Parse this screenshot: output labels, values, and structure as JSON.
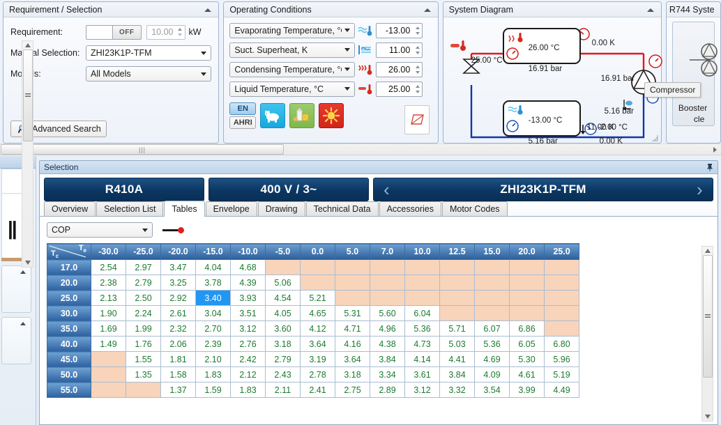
{
  "requirement_panel": {
    "title": "Requirement / Selection",
    "requirement_label": "Requirement:",
    "toggle_state": "OFF",
    "capacity_value": "10.00",
    "capacity_unit": "kW",
    "manual_selection_label": "Manual Selection:",
    "manual_selection_value": "ZHI23K1P-TFM",
    "models_label": "Models:",
    "models_value": "All Models",
    "advanced_search_label": "Advanced Search"
  },
  "operating_conditions": {
    "title": "Operating Conditions",
    "rows": [
      {
        "label": "Evaporating Temperature, °C",
        "icon": "evaporator-icon",
        "value": "-13.00"
      },
      {
        "label": "Suct. Superheat, K",
        "icon": "superheat-icon",
        "value": "11.00"
      },
      {
        "label": "Condensing Temperature, °C",
        "icon": "condenser-icon",
        "value": "26.00"
      },
      {
        "label": "Liquid Temperature, °C",
        "icon": "liquid-icon",
        "value": "25.00"
      }
    ],
    "standard_en": "EN",
    "standard_ahri": "AHRI",
    "app_buttons": [
      {
        "name": "low-temperature-application",
        "glyph": "🐻‍❄"
      },
      {
        "name": "medium-temperature-application",
        "glyph": "🧀"
      },
      {
        "name": "high-temperature-application",
        "glyph": "☀"
      }
    ],
    "ph_diagram_button": "ph-diagram-icon"
  },
  "system_diagram": {
    "title": "System Diagram",
    "condenser_temp": "26.00 °C",
    "condenser_pressure": "16.91 bar",
    "discharge_subcool": "0.00 K",
    "liquid_temp": "25.00 °C",
    "high_pressure": "16.91 bar",
    "low_pressure": "5.16 bar",
    "suction_temp": "-2.00 °C",
    "evaporating_temp": "-13.00 °C",
    "evaporating_pressure": "5.16 bar",
    "superheat": "11.00 K",
    "suction_line_loss": "0.00 K",
    "tooltip": "Compressor"
  },
  "r744_panel": {
    "title": "R744 Syste",
    "subtitle_line1": "Booster",
    "subtitle_line2": "cle"
  },
  "selection": {
    "header_title": "Selection",
    "refrigerant": "R410A",
    "voltage": "400 V / 3~",
    "model": "ZHI23K1P-TFM",
    "prev_arrow": "‹",
    "next_arrow": "›",
    "tabs": [
      {
        "label": "Overview",
        "active": false
      },
      {
        "label": "Selection List",
        "active": false
      },
      {
        "label": "Tables",
        "active": true
      },
      {
        "label": "Envelope",
        "active": false
      },
      {
        "label": "Drawing",
        "active": false
      },
      {
        "label": "Technical Data",
        "active": false
      },
      {
        "label": "Accessories",
        "active": false
      },
      {
        "label": "Motor Codes",
        "active": false
      }
    ],
    "quantity_select": "COP"
  },
  "chart_data": {
    "type": "table",
    "title": "COP",
    "row_axis_label": "Tc",
    "col_axis_label": "Te",
    "categories": [
      "-30.0",
      "-25.0",
      "-20.0",
      "-15.0",
      "-10.0",
      "-5.0",
      "0.0",
      "5.0",
      "7.0",
      "10.0",
      "12.5",
      "15.0",
      "20.0",
      "25.0"
    ],
    "rows": [
      {
        "label": "17.0",
        "values": [
          "2.54",
          "2.97",
          "3.47",
          "4.04",
          "4.68",
          "",
          "",
          "",
          "",
          "",
          "",
          "",
          "",
          ""
        ]
      },
      {
        "label": "20.0",
        "values": [
          "2.38",
          "2.79",
          "3.25",
          "3.78",
          "4.39",
          "5.06",
          "",
          "",
          "",
          "",
          "",
          "",
          "",
          ""
        ]
      },
      {
        "label": "25.0",
        "values": [
          "2.13",
          "2.50",
          "2.92",
          "3.40",
          "3.93",
          "4.54",
          "5.21",
          "",
          "",
          "",
          "",
          "",
          "",
          ""
        ]
      },
      {
        "label": "30.0",
        "values": [
          "1.90",
          "2.24",
          "2.61",
          "3.04",
          "3.51",
          "4.05",
          "4.65",
          "5.31",
          "5.60",
          "6.04",
          "",
          "",
          "",
          ""
        ]
      },
      {
        "label": "35.0",
        "values": [
          "1.69",
          "1.99",
          "2.32",
          "2.70",
          "3.12",
          "3.60",
          "4.12",
          "4.71",
          "4.96",
          "5.36",
          "5.71",
          "6.07",
          "6.86",
          ""
        ]
      },
      {
        "label": "40.0",
        "values": [
          "1.49",
          "1.76",
          "2.06",
          "2.39",
          "2.76",
          "3.18",
          "3.64",
          "4.16",
          "4.38",
          "4.73",
          "5.03",
          "5.36",
          "6.05",
          "6.80"
        ]
      },
      {
        "label": "45.0",
        "values": [
          "",
          "1.55",
          "1.81",
          "2.10",
          "2.42",
          "2.79",
          "3.19",
          "3.64",
          "3.84",
          "4.14",
          "4.41",
          "4.69",
          "5.30",
          "5.96"
        ]
      },
      {
        "label": "50.0",
        "values": [
          "",
          "1.35",
          "1.58",
          "1.83",
          "2.12",
          "2.43",
          "2.78",
          "3.18",
          "3.34",
          "3.61",
          "3.84",
          "4.09",
          "4.61",
          "5.19"
        ]
      },
      {
        "label": "55.0",
        "values": [
          "",
          "",
          "1.37",
          "1.59",
          "1.83",
          "2.11",
          "2.41",
          "2.75",
          "2.89",
          "3.12",
          "3.32",
          "3.54",
          "3.99",
          "4.49"
        ]
      }
    ],
    "selected_cell": {
      "row": "25.0",
      "col": "-15.0",
      "value": "3.40"
    },
    "empty_cell_meaning": "out-of-envelope",
    "value_color": "#1b7a32",
    "empty_color": "#f8d4ba",
    "header_color": "#2c5f9b"
  }
}
